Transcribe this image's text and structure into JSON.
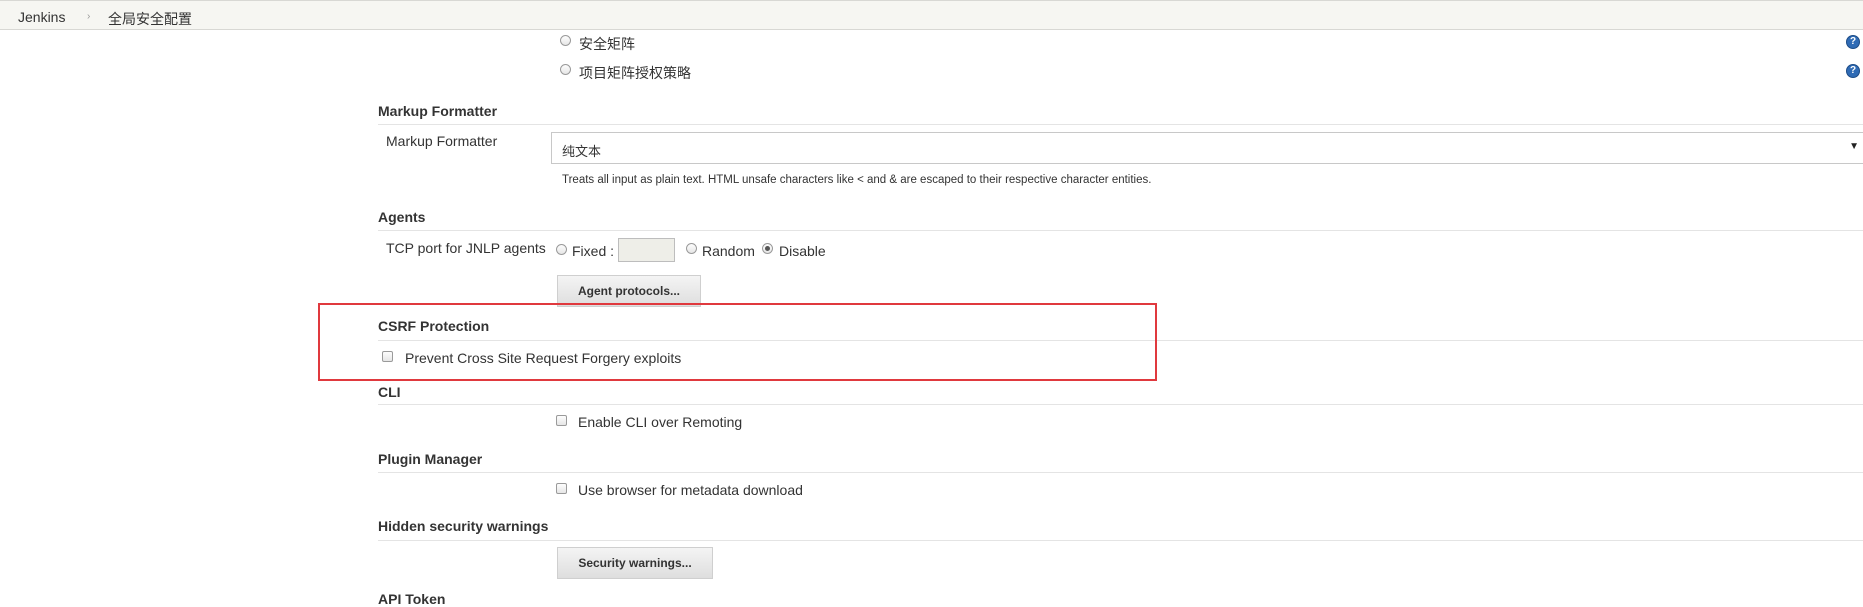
{
  "breadcrumb": {
    "items": [
      "Jenkins",
      "全局安全配置"
    ]
  },
  "authorization": {
    "options": [
      "安全矩阵",
      "项目矩阵授权策略"
    ]
  },
  "markup_formatter": {
    "section_title": "Markup Formatter",
    "field_label": "Markup Formatter",
    "selected": "纯文本",
    "description": "Treats all input as plain text. HTML unsafe characters like < and & are escaped to their respective character entities."
  },
  "agents": {
    "section_title": "Agents",
    "field_label": "TCP port for JNLP agents",
    "options": [
      {
        "label": "Fixed :",
        "checked": false
      },
      {
        "label": "Random",
        "checked": false
      },
      {
        "label": "Disable",
        "checked": true
      }
    ],
    "fixed_port_value": "",
    "button_label": "Agent protocols..."
  },
  "csrf": {
    "section_title": "CSRF Protection",
    "checkbox_label": "Prevent Cross Site Request Forgery exploits",
    "checked": false,
    "highlight_color": "#e0393e"
  },
  "cli": {
    "section_title": "CLI",
    "checkbox_label": "Enable CLI over Remoting",
    "checked": false
  },
  "plugin_manager": {
    "section_title": "Plugin Manager",
    "checkbox_label": "Use browser for metadata download",
    "checked": false
  },
  "hidden_warnings": {
    "section_title": "Hidden security warnings",
    "button_label": "Security warnings..."
  },
  "api_token": {
    "section_title": "API Token"
  },
  "icons": {
    "help": "help-icon",
    "breadcrumb_separator": "chevron-right-icon",
    "dropdown": "caret-down-icon"
  },
  "colors": {
    "topbar_bg": "#f6f6f2",
    "help_icon": "#2f6bb5"
  }
}
